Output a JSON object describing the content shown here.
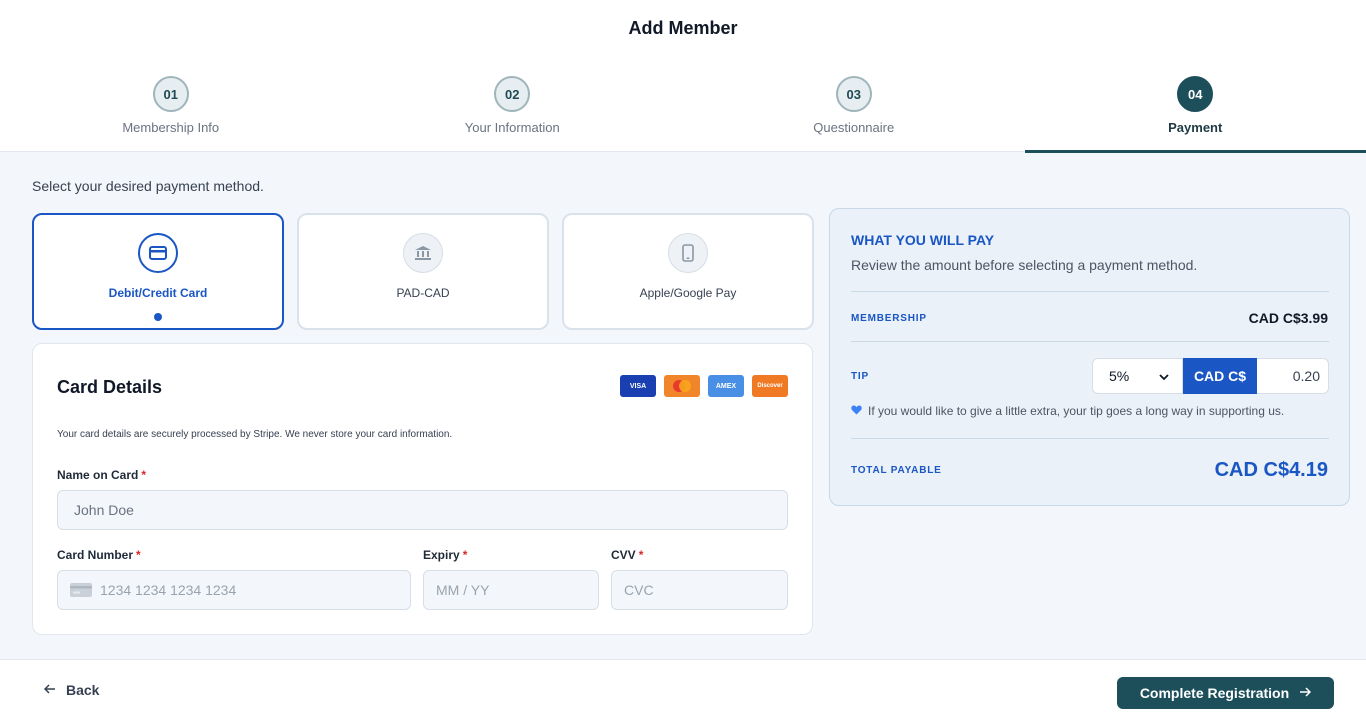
{
  "page": {
    "title": "Add Member"
  },
  "steps": [
    {
      "number": "01",
      "label": "Membership Info"
    },
    {
      "number": "02",
      "label": "Your Information"
    },
    {
      "number": "03",
      "label": "Questionnaire"
    },
    {
      "number": "04",
      "label": "Payment"
    }
  ],
  "payment": {
    "prompt": "Select your desired payment method.",
    "methods": [
      {
        "label": "Debit/Credit Card",
        "icon": "credit-card-icon"
      },
      {
        "label": "PAD-CAD",
        "icon": "bank-icon"
      },
      {
        "label": "Apple/Google Pay",
        "icon": "phone-icon"
      }
    ]
  },
  "card": {
    "title": "Card Details",
    "brands": [
      "VISA",
      "",
      "AMEX",
      "Discover"
    ],
    "secure_note": "Your card details are securely processed by Stripe. We never store your card information.",
    "name_label": "Name on Card",
    "name_value": "John Doe",
    "number_label": "Card Number",
    "number_placeholder": "1234 1234 1234 1234",
    "expiry_label": "Expiry",
    "expiry_placeholder": "MM / YY",
    "cvv_label": "CVV",
    "cvv_placeholder": "CVC",
    "required_mark": "*"
  },
  "summary": {
    "title": "WHAT YOU WILL PAY",
    "subtitle": "Review the amount before selecting a payment method.",
    "membership_label": "MEMBERSHIP",
    "membership_value": "CAD C$3.99",
    "tip_label": "TIP",
    "tip_percent": "5%",
    "tip_currency": "CAD C$",
    "tip_amount": "0.20",
    "tip_note": "If you would like to give a little extra, your tip goes a long way in supporting us.",
    "total_label": "TOTAL PAYABLE",
    "total_value": "CAD C$4.19"
  },
  "footer": {
    "back_label": "Back",
    "complete_label": "Complete Registration"
  },
  "colors": {
    "primary_teal": "#1d4f5b",
    "accent_blue": "#1a56c4",
    "required_red": "#dc2626"
  }
}
